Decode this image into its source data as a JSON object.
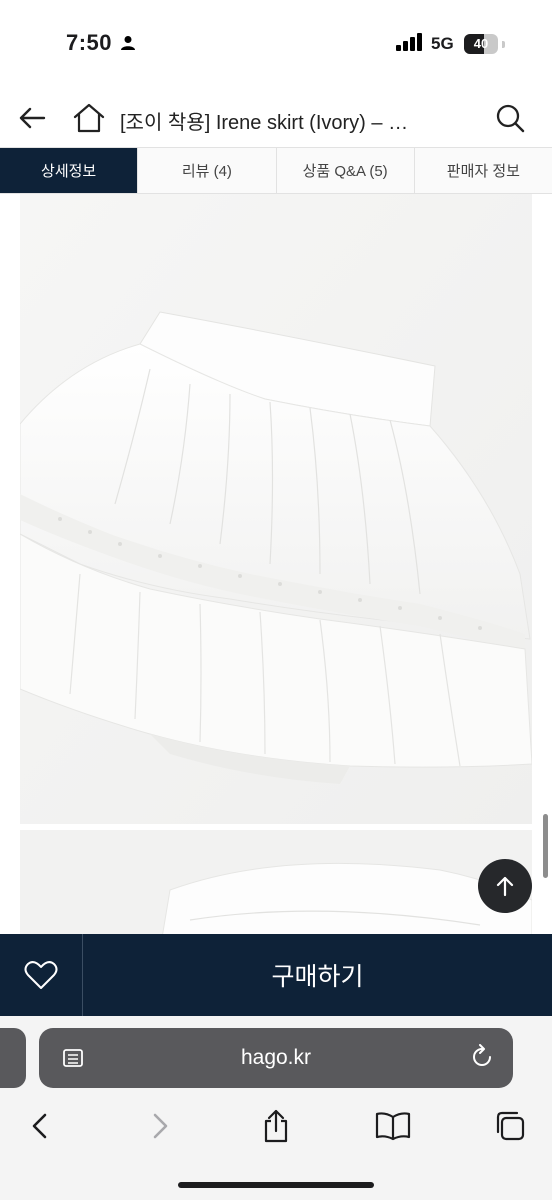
{
  "status_bar": {
    "time": "7:50",
    "network": "5G",
    "battery": "40"
  },
  "header": {
    "title": "[조이 착용] Irene skirt (Ivory) – …"
  },
  "tabs": [
    {
      "label": "상세정보",
      "active": true
    },
    {
      "label": "리뷰 (4)",
      "active": false
    },
    {
      "label": "상품 Q&A (5)",
      "active": false
    },
    {
      "label": "판매자 정보",
      "active": false
    }
  ],
  "buy_bar": {
    "buy_label": "구매하기"
  },
  "browser": {
    "url": "hago.kr"
  },
  "colors": {
    "navy": "#0e2238",
    "urlbar": "#59595c",
    "tab_active_text": "#ffffff"
  },
  "icons": [
    "person-icon",
    "signal-icon",
    "battery-icon",
    "back-arrow-icon",
    "home-icon",
    "search-icon",
    "arrow-up-icon",
    "heart-icon",
    "reader-icon",
    "reload-icon",
    "chevron-left-icon",
    "chevron-right-icon",
    "share-icon",
    "book-icon",
    "tabs-icon"
  ]
}
